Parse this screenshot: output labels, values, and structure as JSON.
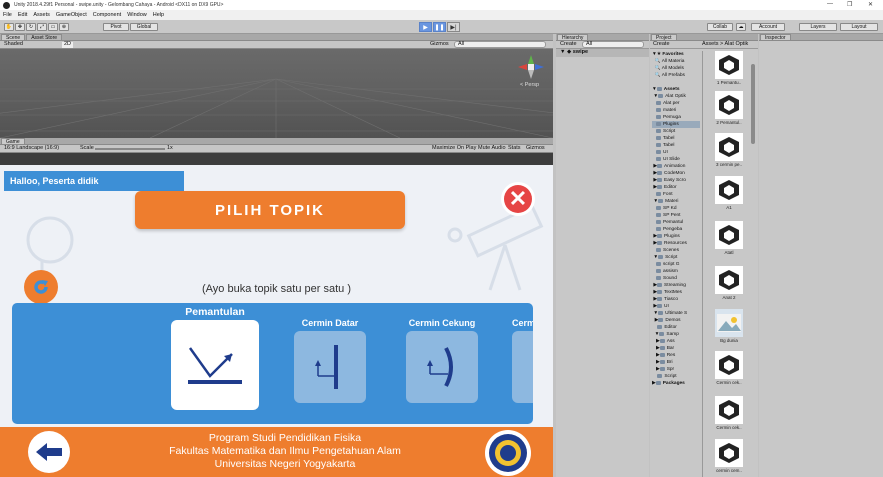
{
  "window": {
    "title": "Unity 2018.4.29f1 Personal - swipe.unity - Gelombang Cahaya - Android <DX11 on DX9 GPU>"
  },
  "menu": [
    "File",
    "Edit",
    "Assets",
    "GameObject",
    "Component",
    "Window",
    "Help"
  ],
  "toolbar": {
    "pivot": "Pivot",
    "global": "Global",
    "account": "Account",
    "layers": "Layers",
    "layout": "Layout",
    "collab": "Collab"
  },
  "scene": {
    "tabs": [
      "Scene",
      "Asset Store"
    ],
    "shading": "Shaded",
    "mode": "2D",
    "gizmos": "Gizmos",
    "search": "All",
    "gizmo_label": "< Persp"
  },
  "game": {
    "tab": "Game",
    "resolution": "16:9 Landscape (16:9)",
    "scale_label": "Scale",
    "scale_value": "1x",
    "options": [
      "Maximize On Play",
      "Mute Audio",
      "Stats",
      "Gizmos"
    ]
  },
  "app": {
    "greeting": "Halloo, Peserta didik",
    "title": "PILIH TOPIK",
    "subtitle": "(Ayo buka topik satu per satu )",
    "topics": [
      "Pemantulan",
      "Cermin Datar",
      "Cermin Cekung",
      "Cerm"
    ],
    "footer": [
      "Program Studi Pendidikan Fisika",
      "Fakultas Matematika dan Ilmu Pengetahuan Alam",
      "Universitas Negeri Yogyakarta"
    ]
  },
  "hierarchy": {
    "tab": "Hierarchy",
    "create": "Create",
    "search": "All",
    "scene": "swipe"
  },
  "project": {
    "tab": "Project",
    "create": "Create",
    "favorites": [
      "Favorites",
      "All Materia",
      "All Models",
      "All Prefabs"
    ],
    "assets": [
      "Assets",
      "Alat Optik",
      "Alat per",
      "materi",
      "Pemuga",
      "Plugins",
      "Script",
      "Tabel",
      "Tabel",
      "UI",
      "UI Slide",
      "Animation",
      "CodeMon",
      "Easy Scro",
      "Editor",
      "Font",
      "Materi",
      "SP Kd",
      "SP Pent",
      "Pemantul",
      "Pengeba",
      "Plugins",
      "Resources",
      "Scenes",
      "Script",
      "script G",
      "assism",
      "Sound",
      "Streaming",
      "TextMes",
      "Tiasco",
      "UI",
      "Ultimate S",
      "Demos",
      "Editor",
      "Samp",
      "Ass",
      "Bar",
      "Res",
      "Bri",
      "Spr",
      "Script",
      "Packages"
    ],
    "breadcrumb": "Assets > Alat Optik",
    "files": [
      "1 Pemantu..",
      "2 Pemantul..",
      "3 cermin pe..",
      "A1",
      "Atatl",
      "Anat 2",
      "Bg dunia",
      "Cermin cek..",
      "Cermin cek..",
      "cermin cem.."
    ]
  },
  "inspector": {
    "tab": "Inspector"
  },
  "colors": {
    "accent_blue": "#3d8fd6",
    "accent_orange": "#ee7d2e",
    "close_red": "#e64545",
    "panel_bg": "#c8c8c8"
  }
}
